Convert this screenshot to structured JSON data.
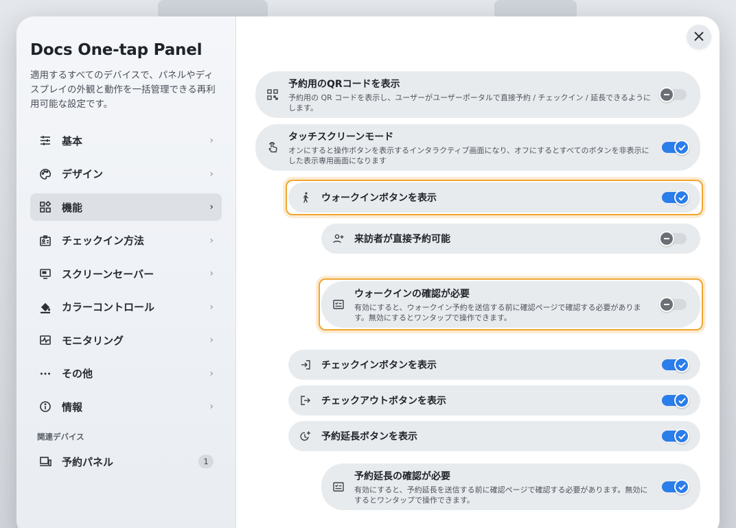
{
  "sidebar": {
    "title": "Docs One-tap Panel",
    "description": "適用するすべてのデバイスで、パネルやディスプレイの外観と動作を一括管理できる再利用可能な設定です。",
    "items": [
      {
        "label": "基本",
        "icon": "sliders-icon"
      },
      {
        "label": "デザイン",
        "icon": "palette-icon"
      },
      {
        "label": "機能",
        "icon": "widgets-icon"
      },
      {
        "label": "チェックイン方法",
        "icon": "badge-icon"
      },
      {
        "label": "スクリーンセーバー",
        "icon": "monitor-icon"
      },
      {
        "label": "カラーコントロール",
        "icon": "paint-bucket-icon"
      },
      {
        "label": "モニタリング",
        "icon": "pulse-icon"
      },
      {
        "label": "その他",
        "icon": "more-icon"
      },
      {
        "label": "情報",
        "icon": "info-icon"
      }
    ],
    "related_section": "関連デバイス",
    "related": {
      "label": "予約パネル",
      "count": "1"
    }
  },
  "settings": {
    "qr": {
      "title": "予約用のQRコードを表示",
      "desc": "予約用の QR コードを表示し、ユーザーがユーザーポータルで直接予約 / チェックイン / 延長できるようにします。",
      "on": false
    },
    "touch": {
      "title": "タッチスクリーンモード",
      "desc": "オンにすると操作ボタンを表示するインタラクティブ画面になり、オフにするとすべてのボタンを非表示にした表示専用画面になります",
      "on": true
    },
    "walkin": {
      "title": "ウォークインボタンを表示",
      "on": true
    },
    "visitor": {
      "title": "来訪者が直接予約可能",
      "on": false
    },
    "walkin_confirm": {
      "title": "ウォークインの確認が必要",
      "desc": "有効にすると、ウォークイン予約を送信する前に確認ページで確認する必要があります。無効にするとワンタップで操作できます。",
      "on": false
    },
    "checkin": {
      "title": "チェックインボタンを表示",
      "on": true
    },
    "checkout": {
      "title": "チェックアウトボタンを表示",
      "on": true
    },
    "extend": {
      "title": "予約延長ボタンを表示",
      "on": true
    },
    "extend_confirm": {
      "title": "予約延長の確認が必要",
      "desc": "有効にすると、予約延長を送信する前に確認ページで確認する必要があります。無効にするとワンタップで操作できます。",
      "on": true
    }
  },
  "colors": {
    "accent": "#2b7de9",
    "highlight": "#f0a530"
  }
}
